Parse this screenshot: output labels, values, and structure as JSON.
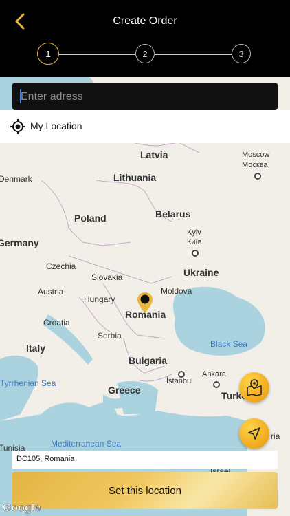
{
  "header": {
    "title": "Create Order",
    "steps": [
      "1",
      "2",
      "3"
    ],
    "active_step": 1
  },
  "search": {
    "placeholder": "Enter adress",
    "value": ""
  },
  "my_location": {
    "label": "My Location"
  },
  "map": {
    "countries": {
      "latvia": "Latvia",
      "lithuania": "Lithuania",
      "denmark": "Denmark",
      "poland": "Poland",
      "belarus": "Belarus",
      "germany": "Germany",
      "czechia": "Czechia",
      "slovakia": "Slovakia",
      "ukraine": "Ukraine",
      "austria": "Austria",
      "hungary": "Hungary",
      "moldova": "Moldova",
      "romania": "Romania",
      "croatia": "Croatia",
      "serbia": "Serbia",
      "italy": "Italy",
      "bulgaria": "Bulgaria",
      "greece": "Greece",
      "turkey": "Turke",
      "tunisia": "Tunisia",
      "israel": "Israel",
      "syria": "ria"
    },
    "cities": {
      "moscow": "Moscow",
      "moscow_local": "Москва",
      "kyiv": "Kyiv",
      "kyiv_local": "Київ",
      "istanbul": "İstanbul",
      "ankara": "Ankara"
    },
    "seas": {
      "black_sea": "Black Sea",
      "tyrrhenian_sea": "Tyrrhenian Sea",
      "mediterranean_sea": "Mediterranean Sea"
    },
    "attribution": "Google"
  },
  "selected_address": "DC105, Romania",
  "cta": {
    "label": "Set this location"
  },
  "colors": {
    "accent": "#e8b53e",
    "header_bg": "#000000"
  }
}
